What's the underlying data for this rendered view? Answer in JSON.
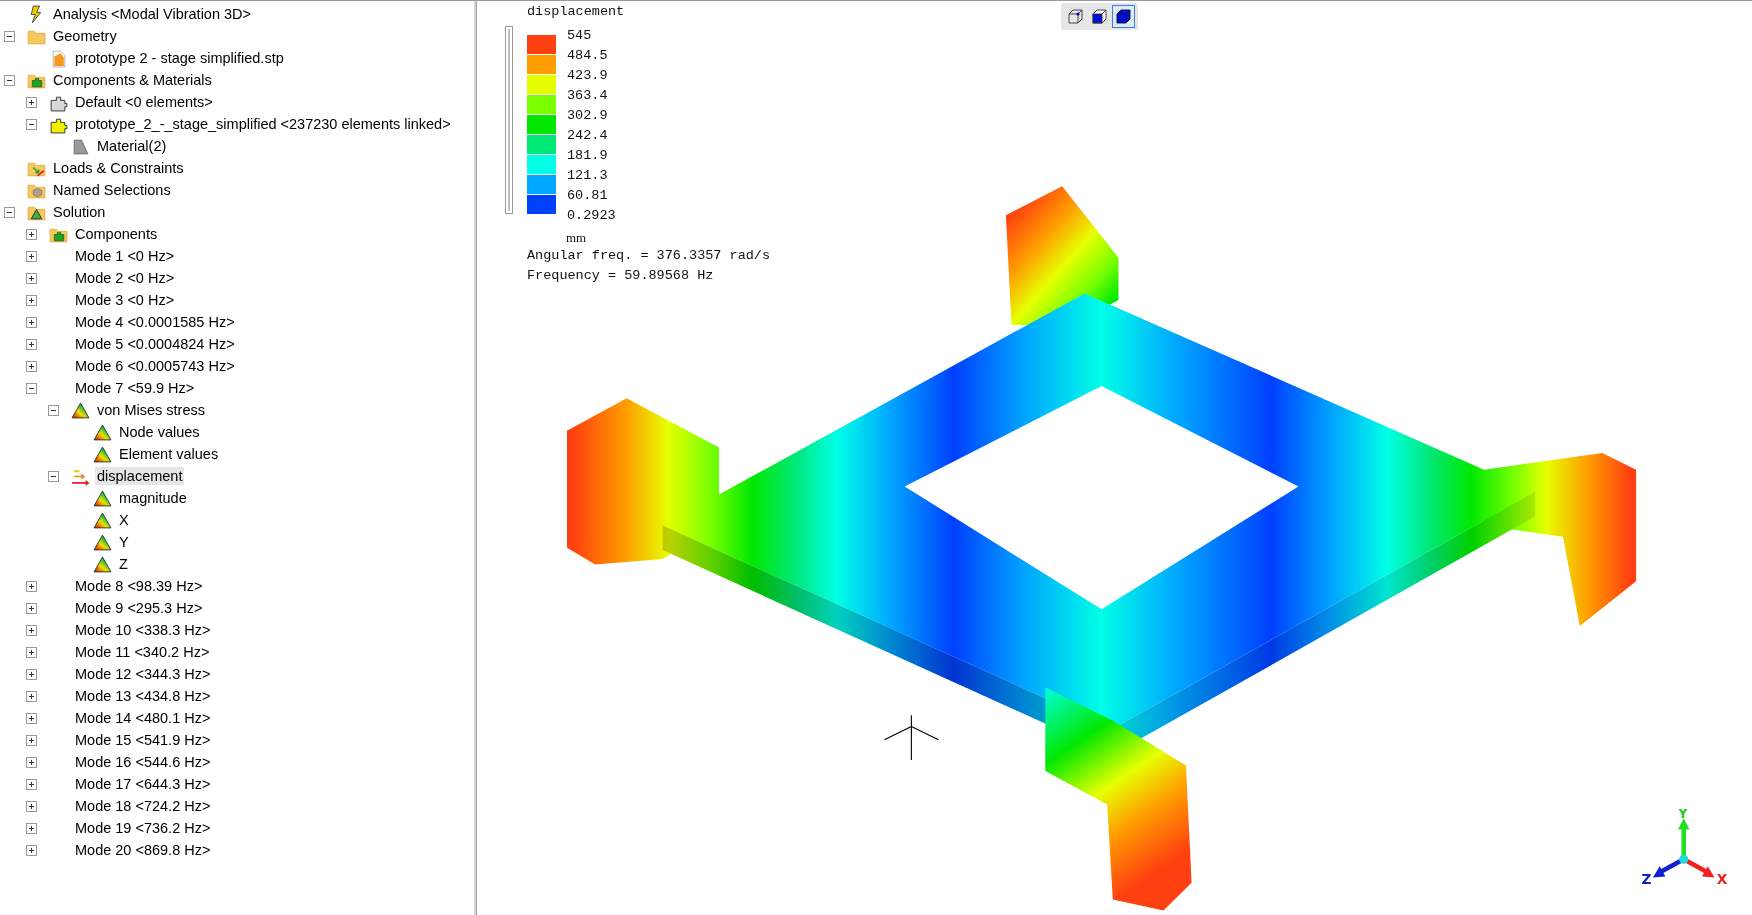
{
  "tree": [
    {
      "label": "Analysis <Modal Vibration 3D>",
      "kind": "bolt",
      "selected": false
    },
    {
      "label": "Geometry",
      "kind": "folder",
      "expanded": true,
      "selected": false,
      "children": [
        {
          "label": "prototype 2 - stage simplified.stp",
          "kind": "file",
          "selected": false
        }
      ]
    },
    {
      "label": "Components & Materials",
      "kind": "puzzle-folder",
      "expanded": true,
      "selected": false,
      "children": [
        {
          "label": "Default <0 elements>",
          "kind": "puzzle-gray",
          "expanded": false,
          "selected": false
        },
        {
          "label": "prototype_2_-_stage_simplified <237230 elements linked>",
          "kind": "puzzle-yellow",
          "expanded": true,
          "selected": false,
          "children": [
            {
              "label": "Material(2)",
              "kind": "material",
              "selected": false
            }
          ]
        }
      ]
    },
    {
      "label": "Loads & Constraints",
      "kind": "loads-folder",
      "selected": false
    },
    {
      "label": "Named Selections",
      "kind": "selection-folder",
      "selected": false
    },
    {
      "label": "Solution",
      "kind": "solution-folder",
      "expanded": true,
      "selected": false,
      "children": [
        {
          "label": "Components",
          "kind": "puzzle-folder",
          "expanded": false,
          "selected": false
        },
        {
          "label": "Mode 1 <0 Hz>",
          "kind": "mode",
          "expanded": false,
          "selected": false
        },
        {
          "label": "Mode 2 <0 Hz>",
          "kind": "mode",
          "expanded": false,
          "selected": false
        },
        {
          "label": "Mode 3 <0 Hz>",
          "kind": "mode",
          "expanded": false,
          "selected": false
        },
        {
          "label": "Mode 4 <0.0001585 Hz>",
          "kind": "mode",
          "expanded": false,
          "selected": false
        },
        {
          "label": "Mode 5 <0.0004824 Hz>",
          "kind": "mode",
          "expanded": false,
          "selected": false
        },
        {
          "label": "Mode 6 <0.0005743 Hz>",
          "kind": "mode",
          "expanded": false,
          "selected": false
        },
        {
          "label": "Mode 7 <59.9 Hz>",
          "kind": "mode",
          "expanded": true,
          "selected": false,
          "children": [
            {
              "label": "von Mises stress",
              "kind": "result",
              "expanded": true,
              "selected": false,
              "children": [
                {
                  "label": "Node values",
                  "kind": "result",
                  "selected": false
                },
                {
                  "label": "Element values",
                  "kind": "result",
                  "selected": false
                }
              ]
            },
            {
              "label": "displacement",
              "kind": "vector",
              "expanded": true,
              "selected": true,
              "children": [
                {
                  "label": "magnitude",
                  "kind": "result",
                  "selected": false
                },
                {
                  "label": "X",
                  "kind": "result",
                  "selected": false
                },
                {
                  "label": "Y",
                  "kind": "result",
                  "selected": false
                },
                {
                  "label": "Z",
                  "kind": "result",
                  "selected": false
                }
              ]
            }
          ]
        },
        {
          "label": "Mode 8 <98.39 Hz>",
          "kind": "mode",
          "expanded": false,
          "selected": false
        },
        {
          "label": "Mode 9 <295.3 Hz>",
          "kind": "mode",
          "expanded": false,
          "selected": false
        },
        {
          "label": "Mode 10 <338.3 Hz>",
          "kind": "mode",
          "expanded": false,
          "selected": false
        },
        {
          "label": "Mode 11 <340.2 Hz>",
          "kind": "mode",
          "expanded": false,
          "selected": false
        },
        {
          "label": "Mode 12 <344.3 Hz>",
          "kind": "mode",
          "expanded": false,
          "selected": false
        },
        {
          "label": "Mode 13 <434.8 Hz>",
          "kind": "mode",
          "expanded": false,
          "selected": false
        },
        {
          "label": "Mode 14 <480.1 Hz>",
          "kind": "mode",
          "expanded": false,
          "selected": false
        },
        {
          "label": "Mode 15 <541.9 Hz>",
          "kind": "mode",
          "expanded": false,
          "selected": false
        },
        {
          "label": "Mode 16 <544.6 Hz>",
          "kind": "mode",
          "expanded": false,
          "selected": false
        },
        {
          "label": "Mode 17 <644.3 Hz>",
          "kind": "mode",
          "expanded": false,
          "selected": false
        },
        {
          "label": "Mode 18 <724.2 Hz>",
          "kind": "mode",
          "expanded": false,
          "selected": false
        },
        {
          "label": "Mode 19 <736.2 Hz>",
          "kind": "mode",
          "expanded": false,
          "selected": false
        },
        {
          "label": "Mode 20 <869.8 Hz>",
          "kind": "mode",
          "expanded": false,
          "selected": false
        }
      ]
    }
  ],
  "legend": {
    "title": "displacement",
    "range": {
      "level": 1
    },
    "bands": [
      {
        "color": "#ff4010"
      },
      {
        "color": "#ff9c00"
      },
      {
        "color": "#e6ff00"
      },
      {
        "color": "#78ff00"
      },
      {
        "color": "#00e800"
      },
      {
        "color": "#00e878"
      },
      {
        "color": "#00ffe6"
      },
      {
        "color": "#00a8ff"
      },
      {
        "color": "#0040ff"
      }
    ],
    "ticks": [
      "545",
      "484.5",
      "423.9",
      "363.4",
      "302.9",
      "242.4",
      "181.9",
      "121.3",
      "60.81",
      "0.2923"
    ],
    "unit": "mm",
    "info": [
      "Angular freq. = 376.3357 rad/s",
      "Frequency = 59.89568 Hz"
    ]
  },
  "view_buttons": [
    {
      "kind": "wireframe",
      "selected": false
    },
    {
      "kind": "solid-edges",
      "selected": false
    },
    {
      "kind": "solid",
      "selected": true
    }
  ],
  "triad": {
    "x": "X",
    "y": "Y",
    "z": "Z"
  }
}
